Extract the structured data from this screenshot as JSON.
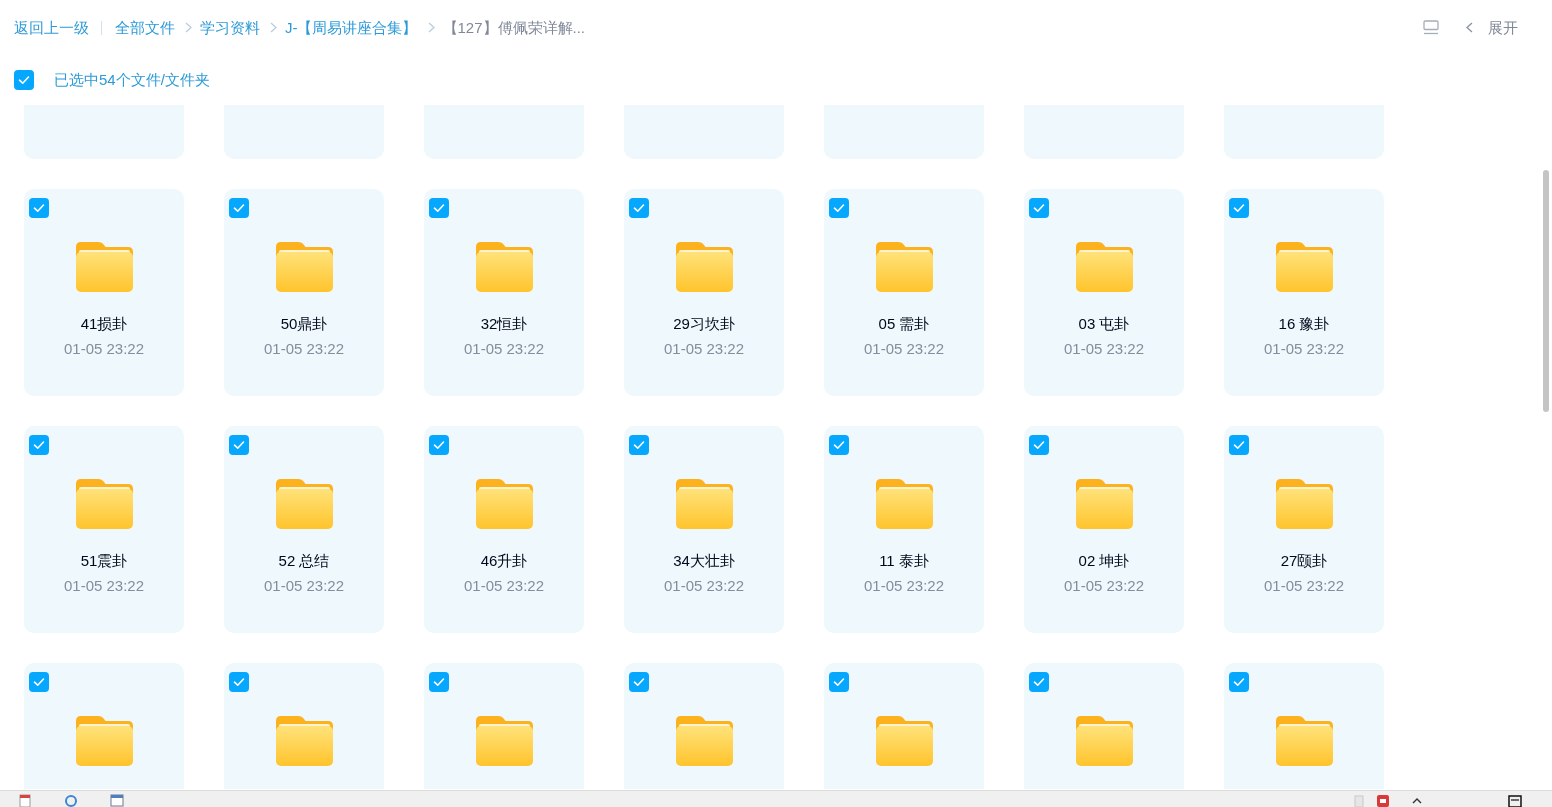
{
  "breadcrumb": {
    "back": "返回上一级",
    "items": [
      {
        "label": "全部文件",
        "current": false
      },
      {
        "label": "学习资料",
        "current": false
      },
      {
        "label": "J-【周易讲座合集】",
        "current": false
      },
      {
        "label": "【127】傅佩荣详解...",
        "current": true
      }
    ]
  },
  "toolbar": {
    "expand_label": "展开"
  },
  "selection": {
    "checked": true,
    "label": "已选中54个文件/文件夹"
  },
  "grid": {
    "rows": [
      {
        "kind": "clipped-top",
        "cards": [
          {
            "kind": "folder"
          },
          {
            "kind": "folder"
          },
          {
            "kind": "folder"
          },
          {
            "kind": "folder"
          },
          {
            "kind": "folder"
          },
          {
            "kind": "folder"
          },
          {
            "kind": "folder"
          }
        ]
      },
      {
        "kind": "full",
        "cards": [
          {
            "kind": "folder",
            "name": "41损卦",
            "date": "01-05 23:22",
            "selected": true
          },
          {
            "kind": "folder",
            "name": "50鼎卦",
            "date": "01-05 23:22",
            "selected": true
          },
          {
            "kind": "folder",
            "name": "32恒卦",
            "date": "01-05 23:22",
            "selected": true
          },
          {
            "kind": "folder",
            "name": "29习坎卦",
            "date": "01-05 23:22",
            "selected": true
          },
          {
            "kind": "folder",
            "name": "05 需卦",
            "date": "01-05 23:22",
            "selected": true
          },
          {
            "kind": "folder",
            "name": "03 屯卦",
            "date": "01-05 23:22",
            "selected": true
          },
          {
            "kind": "folder",
            "name": "16 豫卦",
            "date": "01-05 23:22",
            "selected": true
          }
        ]
      },
      {
        "kind": "full",
        "cards": [
          {
            "kind": "folder",
            "name": "51震卦",
            "date": "01-05 23:22",
            "selected": true
          },
          {
            "kind": "folder",
            "name": "52 总结",
            "date": "01-05 23:22",
            "selected": true
          },
          {
            "kind": "folder",
            "name": "46升卦",
            "date": "01-05 23:22",
            "selected": true
          },
          {
            "kind": "folder",
            "name": "34大壮卦",
            "date": "01-05 23:22",
            "selected": true
          },
          {
            "kind": "folder",
            "name": "11 泰卦",
            "date": "01-05 23:22",
            "selected": true
          },
          {
            "kind": "folder",
            "name": "02 坤卦",
            "date": "01-05 23:22",
            "selected": true
          },
          {
            "kind": "folder",
            "name": "27颐卦",
            "date": "01-05 23:22",
            "selected": true
          }
        ]
      },
      {
        "kind": "clipped-bottom",
        "cards": [
          {
            "kind": "folder",
            "selected": true
          },
          {
            "kind": "folder",
            "selected": true
          },
          {
            "kind": "folder",
            "selected": true
          },
          {
            "kind": "folder",
            "selected": true
          },
          {
            "kind": "folder",
            "selected": true
          },
          {
            "kind": "folder",
            "selected": true
          },
          {
            "kind": "folder",
            "selected": true
          }
        ]
      }
    ]
  }
}
